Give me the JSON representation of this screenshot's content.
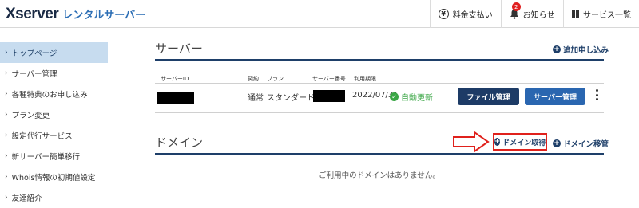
{
  "header": {
    "logo_brand": "Xserver",
    "logo_sub": "レンタルサーバー",
    "menu": [
      {
        "label": "料金支払い",
        "icon": "yen-icon"
      },
      {
        "label": "お知らせ",
        "icon": "bell-icon",
        "badge": "2"
      },
      {
        "label": "サービス一覧",
        "icon": "grid-icon"
      }
    ]
  },
  "sidebar": {
    "items": [
      {
        "label": "トップページ",
        "active": true
      },
      {
        "label": "サーバー管理"
      },
      {
        "label": "各種特典のお申し込み"
      },
      {
        "label": "プラン変更"
      },
      {
        "label": "設定代行サービス"
      },
      {
        "label": "新サーバー簡単移行"
      },
      {
        "label": "Whois情報の初期値設定"
      },
      {
        "label": "友達紹介"
      }
    ]
  },
  "server_section": {
    "title": "サーバー",
    "add_label": "追加申し込み",
    "columns": [
      "サーバーID",
      "契約",
      "プラン",
      "サーバー番号",
      "利用期限"
    ],
    "row": {
      "contract": "通常",
      "plan": "スタンダード",
      "expiry": "2022/07/31",
      "auto_renew": "自動更新",
      "file_button": "ファイル管理",
      "server_button": "サーバー管理"
    }
  },
  "domain_section": {
    "title": "ドメイン",
    "get_label": "ドメイン取得",
    "transfer_label": "ドメイン移管",
    "empty_message": "ご利用中のドメインはありません。"
  },
  "colors": {
    "navy": "#1e3f69",
    "button_blue": "#2a66b0",
    "active_sidebar": "#c7dcef",
    "highlight_red": "#e0211c",
    "renew_green": "#3aa645"
  }
}
